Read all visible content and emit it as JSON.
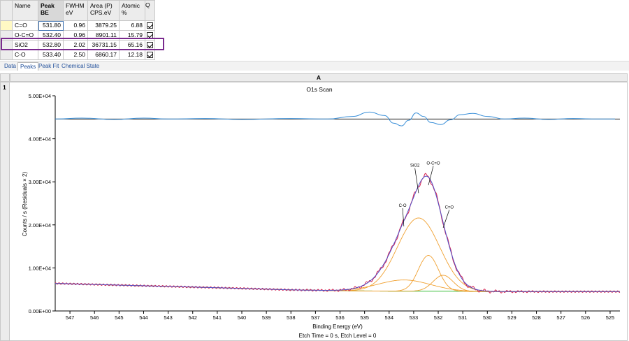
{
  "peak_table": {
    "headers": [
      {
        "line1": "Name",
        "line2": ""
      },
      {
        "line1": "Peak",
        "line2": "BE"
      },
      {
        "line1": "FWHM",
        "line2": "eV"
      },
      {
        "line1": "Area (P)",
        "line2": "CPS.eV"
      },
      {
        "line1": "Atomic",
        "line2": "%"
      },
      {
        "line1": "Q",
        "line2": ""
      }
    ],
    "rows": [
      {
        "name": "C=O",
        "be": "531.80",
        "fwhm": "0.96",
        "area": "3879.25",
        "atomic": "6.88",
        "q": true
      },
      {
        "name": "O-C=O",
        "be": "532.40",
        "fwhm": "0.96",
        "area": "8901.11",
        "atomic": "15.79",
        "q": true
      },
      {
        "name": "SiO2",
        "be": "532.80",
        "fwhm": "2.02",
        "area": "36731.15",
        "atomic": "65.16",
        "q": true
      },
      {
        "name": "C-O",
        "be": "533.40",
        "fwhm": "2.50",
        "area": "6860.17",
        "atomic": "12.18",
        "q": true
      }
    ],
    "highlight_color": "#7a2a8e"
  },
  "tabs": [
    {
      "label": "Data",
      "active": false
    },
    {
      "label": "Peaks",
      "active": true
    },
    {
      "label": "Peak Fit",
      "active": false
    },
    {
      "label": "Chemical State",
      "active": false
    }
  ],
  "grid": {
    "column_label": "A",
    "row_label": "1"
  },
  "colors": {
    "envelope": "#d6204f",
    "envelope_fit": "#5252c8",
    "components": "#f0a030",
    "background": "#3fbf3f",
    "residual": "#3a8fd8",
    "raw": "#7a2040",
    "axis": "#000000"
  },
  "chart_data": {
    "type": "line",
    "title": "O1s Scan",
    "xlabel": "Binding Energy (eV)",
    "ylabel": "Counts / s  (Residuals × 2)",
    "footer": "Etch Time = 0 s, Etch Level = 0",
    "xlim": [
      547.6,
      524.6
    ],
    "ylim": [
      0,
      50000
    ],
    "x_ticks": [
      547,
      546,
      545,
      544,
      543,
      542,
      541,
      540,
      539,
      538,
      537,
      536,
      535,
      534,
      533,
      532,
      531,
      530,
      529,
      528,
      527,
      526,
      525
    ],
    "y_ticks": [
      {
        "value": 0,
        "label": "0.00E+00"
      },
      {
        "value": 10000,
        "label": "1.00E+04"
      },
      {
        "value": 20000,
        "label": "2.00E+04"
      },
      {
        "value": 30000,
        "label": "3.00E+04"
      },
      {
        "value": 40000,
        "label": "4.00E+04"
      },
      {
        "value": 50000,
        "label": "5.00E+04"
      }
    ],
    "background_points": [
      [
        547.6,
        6400
      ],
      [
        545,
        6000
      ],
      [
        541,
        5400
      ],
      [
        538,
        4900
      ],
      [
        536,
        4700
      ],
      [
        534,
        4600
      ],
      [
        532,
        4600
      ],
      [
        530,
        4500
      ],
      [
        527,
        4500
      ],
      [
        524.6,
        4500
      ]
    ],
    "peaks": [
      {
        "name": "C=O",
        "center": 531.8,
        "fwhm": 0.96,
        "height": 3700
      },
      {
        "name": "O-C=O",
        "center": 532.4,
        "fwhm": 0.96,
        "height": 8300
      },
      {
        "name": "SiO2",
        "center": 532.8,
        "fwhm": 2.02,
        "height": 17000
      },
      {
        "name": "C-O",
        "center": 533.4,
        "fwhm": 2.5,
        "height": 2600
      }
    ],
    "residual_baseline": 44600,
    "residual_points": [
      [
        547.6,
        44600
      ],
      [
        546.5,
        44800
      ],
      [
        545.2,
        44500
      ],
      [
        544,
        44800
      ],
      [
        543,
        44600
      ],
      [
        541.5,
        44700
      ],
      [
        540,
        44500
      ],
      [
        538,
        44700
      ],
      [
        536.5,
        44600
      ],
      [
        535.5,
        45200
      ],
      [
        534.8,
        46200
      ],
      [
        534.2,
        45400
      ],
      [
        533.8,
        43600
      ],
      [
        533.5,
        43000
      ],
      [
        533.2,
        44300
      ],
      [
        532.9,
        46000
      ],
      [
        532.6,
        45200
      ],
      [
        532.3,
        43800
      ],
      [
        531.9,
        43300
      ],
      [
        531.5,
        44400
      ],
      [
        531.1,
        45600
      ],
      [
        530.6,
        45900
      ],
      [
        530,
        45200
      ],
      [
        529.3,
        44600
      ],
      [
        528.5,
        44800
      ],
      [
        527.5,
        44500
      ],
      [
        526.5,
        44700
      ],
      [
        525.5,
        44600
      ],
      [
        524.8,
        44600
      ]
    ],
    "label_positions": [
      {
        "name": "SiO2",
        "tx": 532.95,
        "ty": 33500
      },
      {
        "name": "O-C=O",
        "tx": 532.2,
        "ty": 34000
      },
      {
        "name": "C-O",
        "tx": 533.45,
        "ty": 24200
      },
      {
        "name": "C=O",
        "tx": 531.55,
        "ty": 23800
      }
    ]
  }
}
